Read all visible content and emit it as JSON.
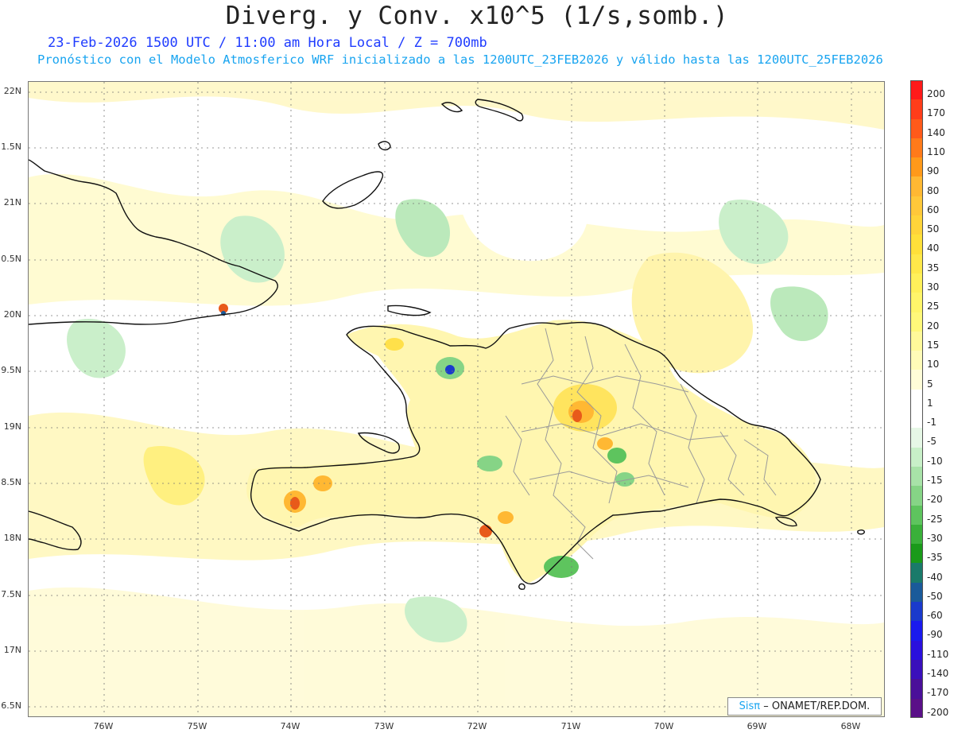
{
  "title": "Diverg. y Conv. x10^5 (1/s,somb.)",
  "subtitle_line1": "23-Feb-2026  1500 UTC / 11:00 am Hora Local / Z = 700mb",
  "subtitle_line2": "Pronóstico con el Modelo Atmosferico WRF inicializado a las 1200UTC_23FEB2026 y válido hasta las  1200UTC_25FEB2026",
  "map": {
    "lat_labels": [
      "22N",
      "1.5N",
      "21N",
      "0.5N",
      "20N",
      "9.5N",
      "19N",
      "8.5N",
      "18N",
      "7.5N",
      "17N",
      "6.5N"
    ],
    "lon_labels": [
      "76W",
      "75W",
      "74W",
      "73W",
      "72W",
      "71W",
      "70W",
      "69W",
      "68W"
    ],
    "colors": {
      "ocean": "#ffffff",
      "light_green": "#c8efc8",
      "green": "#7fd07f",
      "yellow_light": "#fff8b8",
      "yellow": "#fff07a",
      "orange": "#ffb833",
      "red": "#e85a1a",
      "coast": "#111111",
      "border": "#9a9a9a"
    }
  },
  "colorbar": {
    "labels": [
      "200",
      "170",
      "140",
      "110",
      "90",
      "80",
      "60",
      "50",
      "40",
      "35",
      "30",
      "25",
      "20",
      "15",
      "10",
      "5",
      "1",
      "-1",
      "-5",
      "-10",
      "-15",
      "-20",
      "-25",
      "-30",
      "-35",
      "-40",
      "-50",
      "-60",
      "-90",
      "-110",
      "-140",
      "-170",
      "-200"
    ],
    "colors": [
      "#ff1a1a",
      "#ff3d1a",
      "#ff5a1a",
      "#ff7a1a",
      "#ff991a",
      "#ffb833",
      "#ffc83a",
      "#ffd43a",
      "#ffe03a",
      "#ffe84a",
      "#fff05a",
      "#fff56a",
      "#fff87a",
      "#fff99a",
      "#fffbb8",
      "#fffdd8",
      "#ffffff",
      "#ffffff",
      "#e6f7e6",
      "#c8efc8",
      "#a8e2a8",
      "#86d486",
      "#5ec45e",
      "#3ab03a",
      "#1a9a1a",
      "#1a7a6a",
      "#1a5a9a",
      "#1a3acc",
      "#1a1aee",
      "#2a10dd",
      "#3a10bb",
      "#4a1099",
      "#5a1088"
    ]
  },
  "credit": {
    "logo": "Sisπ",
    "text": "– ONAMET/REP.DOM."
  }
}
